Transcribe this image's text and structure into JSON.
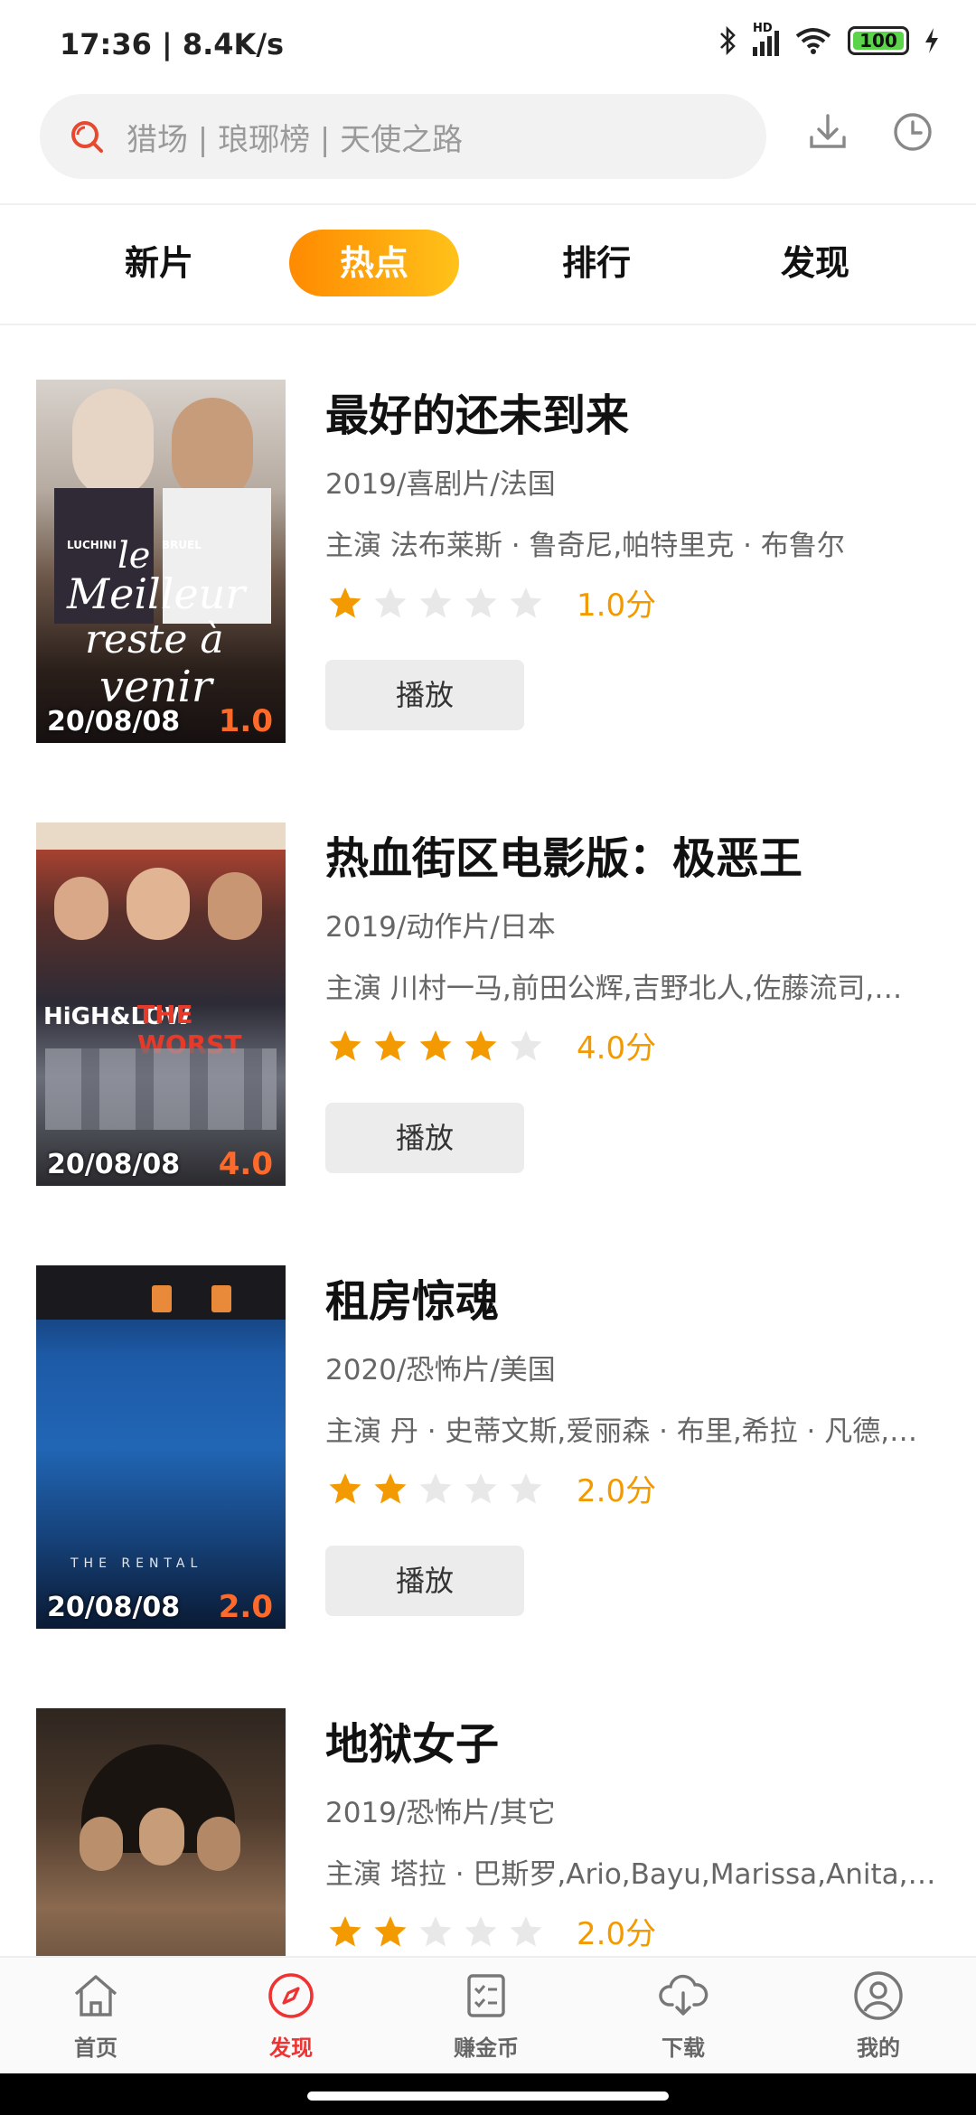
{
  "status_bar": {
    "time": "17:36 | 8.4K/s",
    "battery": "100",
    "signal_label": "HD"
  },
  "search": {
    "placeholder": "猎场 | 琅琊榜 | 天使之路"
  },
  "tabs": [
    {
      "label": "新片",
      "active": false
    },
    {
      "label": "热点",
      "active": true
    },
    {
      "label": "排行",
      "active": false
    },
    {
      "label": "发现",
      "active": false
    }
  ],
  "movies": [
    {
      "title": "最好的还未到来",
      "meta": "2019/喜剧片/法国",
      "cast": "主演 法布莱斯 · 鲁奇尼,帕特里克 · 布鲁尔",
      "rating": 1,
      "score": "1.0分",
      "play_label": "播放",
      "poster_date": "20/08/08",
      "poster_score": "1.0",
      "poster_text_1": "le",
      "poster_text_2": "Meilleur",
      "poster_text_3": "reste à",
      "poster_text_4": "venir",
      "poster_names": "LUCHINI            BRUEL"
    },
    {
      "title": "热血街区电影版：极恶王",
      "meta": "2019/动作片/日本",
      "cast": "主演 川村一马,前田公辉,吉野北人,佐藤流司,…",
      "rating": 4,
      "score": "4.0分",
      "play_label": "播放",
      "poster_date": "20/08/08",
      "poster_score": "4.0",
      "poster_text_1": "HiGH&LOW",
      "poster_text_2": "THE WORST"
    },
    {
      "title": "租房惊魂",
      "meta": "2020/恐怖片/美国",
      "cast": "主演 丹 · 史蒂文斯,爱丽森 · 布里,希拉 · 凡德,…",
      "rating": 2,
      "score": "2.0分",
      "play_label": "播放",
      "poster_date": "20/08/08",
      "poster_score": "2.0",
      "poster_text_1": "THE RENTAL"
    },
    {
      "title": "地狱女子",
      "meta": "2019/恐怖片/其它",
      "cast": "主演 塔拉 · 巴斯罗,Ario,Bayu,Marissa,Anita,…",
      "rating": 2,
      "score": "2.0分",
      "play_label": "播放"
    }
  ],
  "bottom_nav": [
    {
      "label": "首页",
      "icon": "home-icon",
      "active": false
    },
    {
      "label": "发现",
      "icon": "compass-icon",
      "active": true
    },
    {
      "label": "赚金币",
      "icon": "checklist-icon",
      "active": false
    },
    {
      "label": "下载",
      "icon": "cloud-download-icon",
      "active": false
    },
    {
      "label": "我的",
      "icon": "user-icon",
      "active": false
    }
  ],
  "colors": {
    "accent_start": "#ff8a00",
    "accent_end": "#ffc21a",
    "star": "#f29a00",
    "nav_active": "#e33333"
  }
}
